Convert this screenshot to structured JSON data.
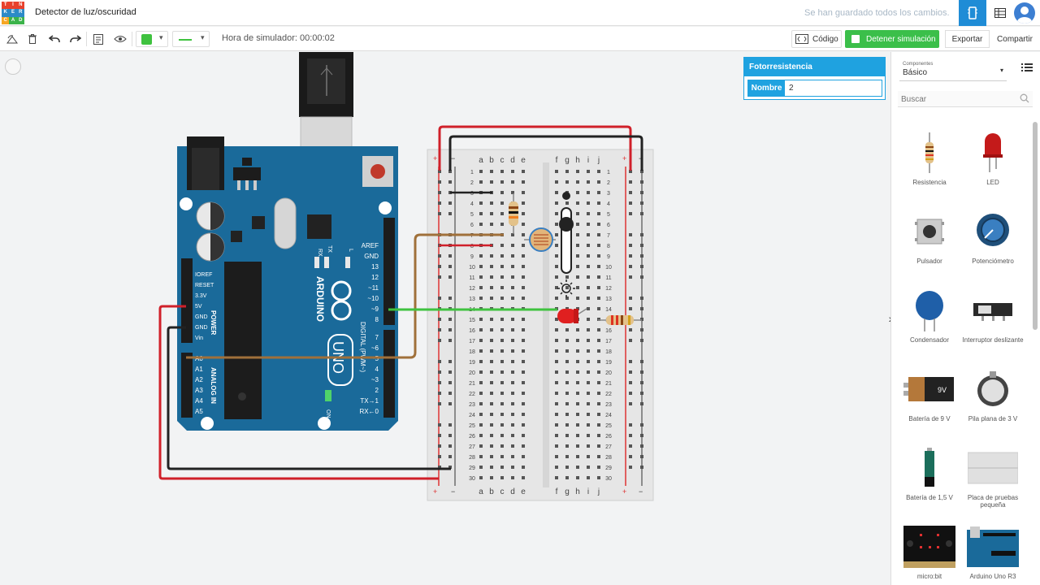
{
  "app": {
    "title": "Detector de luz/oscuridad",
    "saved_status": "Se han guardado todos los cambios.",
    "logo_letters": [
      "TIN",
      "KER",
      "CAD"
    ]
  },
  "toolbar": {
    "sim_time": "Hora de simulador: 00:00:02",
    "code_label": "Código",
    "stop_sim_label": "Detener simulación",
    "export_label": "Exportar",
    "share_label": "Compartir",
    "wire_color": "#3fc23f"
  },
  "inspector": {
    "title": "Fotorresistencia",
    "name_label": "Nombre",
    "name_value": "2"
  },
  "components_panel": {
    "small_label": "Componentes",
    "category": "Básico",
    "search_placeholder": "Buscar",
    "items": [
      {
        "label": "Resistencia"
      },
      {
        "label": "LED"
      },
      {
        "label": "Pulsador"
      },
      {
        "label": "Potenciómetro"
      },
      {
        "label": "Condensador"
      },
      {
        "label": "Interruptor deslizante"
      },
      {
        "label": "Batería de 9 V"
      },
      {
        "label": "Pila plana de 3 V"
      },
      {
        "label": "Batería de 1,5 V"
      },
      {
        "label": "Placa de pruebas pequeña"
      },
      {
        "label": "micro:bit"
      },
      {
        "label": "Arduino Uno R3"
      }
    ]
  },
  "arduino": {
    "brand": "ARDUINO",
    "model": "UNO",
    "power_header": "POWER",
    "analog_header": "ANALOG IN",
    "digital_header": "DIGITAL (PWM~)",
    "on_label": "ON",
    "power_pins": [
      "IOREF",
      "RESET",
      "3.3V",
      "5V",
      "GND",
      "GND",
      "Vin"
    ],
    "analog_pins": [
      "A0",
      "A1",
      "A2",
      "A3",
      "A4",
      "A5"
    ],
    "digital_top": [
      "AREF",
      "GND",
      "13",
      "12",
      "~11",
      "~10",
      "~9",
      "8"
    ],
    "digital_bottom": [
      "7",
      "~6",
      "~5",
      "4",
      "~3",
      "2",
      "TX→1",
      "RX←0"
    ],
    "tx_label": "TX",
    "rx_label": "RX",
    "l_label": "L"
  },
  "breadboard": {
    "cols_left": [
      "a",
      "b",
      "c",
      "d",
      "e"
    ],
    "cols_right": [
      "f",
      "g",
      "h",
      "i",
      "j"
    ],
    "rows": 30,
    "plus": "+",
    "minus": "−"
  }
}
